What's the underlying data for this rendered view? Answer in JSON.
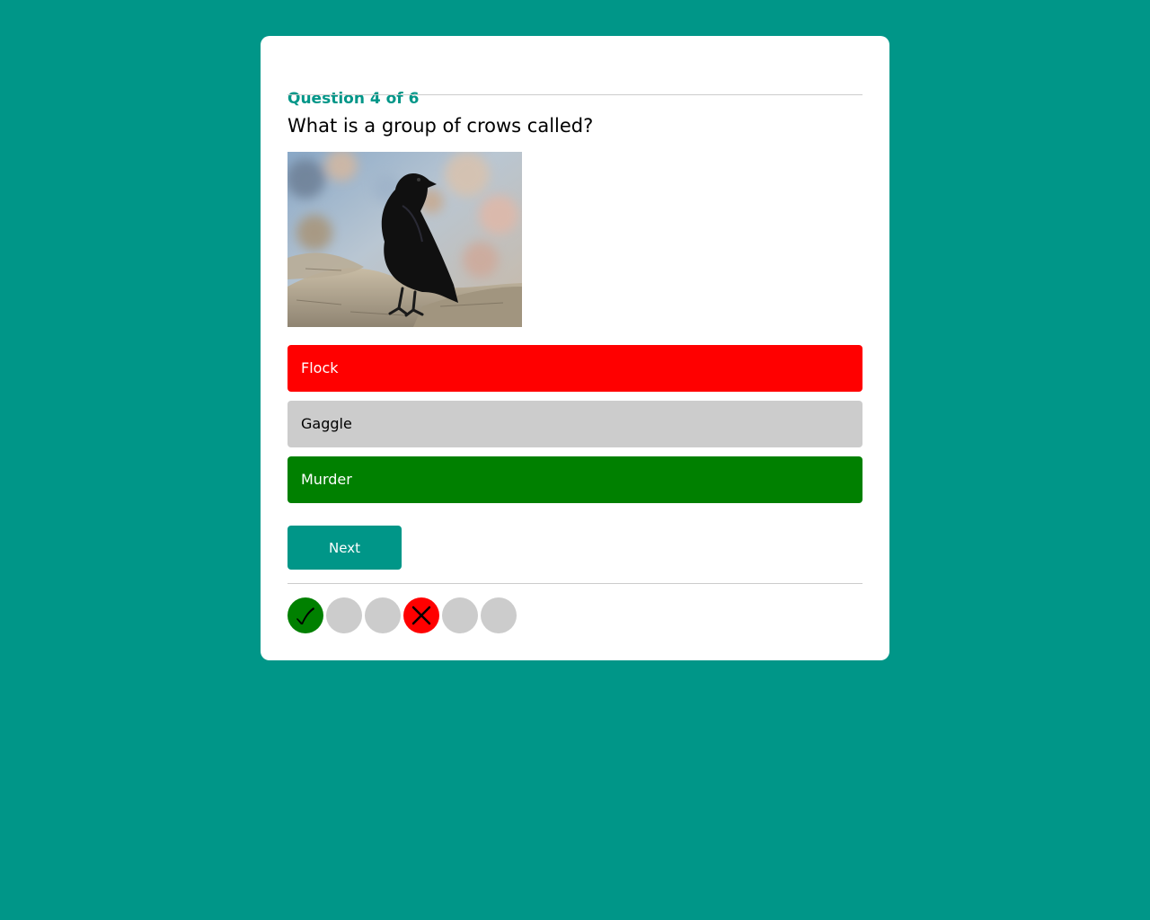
{
  "quiz": {
    "question_counter": "Question 4 of 6",
    "question_text": "What is a group of crows called?",
    "image": {
      "subject": "black crow perched on a tree branch",
      "icon": "crow-photo"
    },
    "options": [
      {
        "label": "Flock",
        "state": "incorrect-selected"
      },
      {
        "label": "Gaggle",
        "state": "neutral"
      },
      {
        "label": "Murder",
        "state": "correct"
      }
    ],
    "next_label": "Next",
    "progress": [
      {
        "state": "correct",
        "icon": "check-icon"
      },
      {
        "state": "unanswered"
      },
      {
        "state": "unanswered"
      },
      {
        "state": "incorrect",
        "icon": "x-icon"
      },
      {
        "state": "unanswered"
      },
      {
        "state": "unanswered"
      }
    ]
  },
  "colors": {
    "background": "#009688",
    "card": "#ffffff",
    "accent": "#009688",
    "correct": "#008000",
    "incorrect": "#ff0000",
    "neutral": "#cccccc",
    "divider": "#cccccc"
  }
}
